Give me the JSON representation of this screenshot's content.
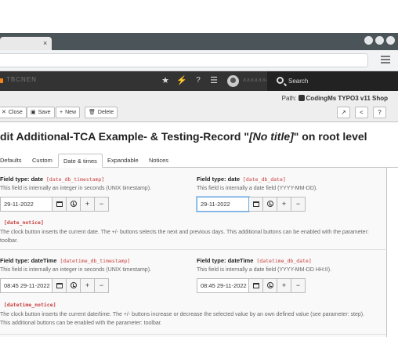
{
  "browser": {
    "tab_close": "×",
    "url": "",
    "menu_icon": "hamburger-icon"
  },
  "topbar": {
    "site_name": "TBCNEN",
    "icons": [
      "star-icon",
      "bolt-icon",
      "help-icon",
      "list-icon"
    ],
    "username": "aaaaaaa",
    "search_label": "Search"
  },
  "docheader": {
    "path_prefix": "Path:",
    "path_value": "CodingMs TYPO3 v11 Shop",
    "buttons": {
      "close": "Close",
      "save": "Save",
      "new": "New",
      "delete": "Delete"
    },
    "right_icons": [
      "open-new-window-icon",
      "share-icon",
      "help-icon"
    ]
  },
  "title": {
    "prefix": "dit Additional-TCA Example- & Testing-Record \"",
    "italic": "[No title]",
    "suffix": "\" on root level"
  },
  "tabs": [
    "Defaults",
    "Custom",
    "Date & times",
    "Expandable",
    "Notices"
  ],
  "active_tab": "Date & times",
  "fields": {
    "date_timestamp": {
      "label": "Field type: date",
      "code": "[date_db_timestamp]",
      "description": "This field is internally an integer in seconds (UNIX timestamp).",
      "value": "29-11-2022"
    },
    "date_date": {
      "label": "Field type: date",
      "code": "[date_db_date]",
      "description": "This field is internally a date field (YYYY-MM-DD).",
      "value": "29-11-2022"
    },
    "date_notice": {
      "code": "[date_notice]",
      "text": "The clock button inserts the current date. The +/- buttons selects the next and previous days. This additional buttons can be enabled with the parameter: toolbar."
    },
    "datetime_timestamp": {
      "label": "Field type: dateTime",
      "code": "[datetime_db_timestamp]",
      "description": "This field is internally an integer in seconds (UNIX timestamp).",
      "value": "08:45 29-11-2022"
    },
    "datetime_date": {
      "label": "Field type: dateTime",
      "code": "[datetime_db_date]",
      "description": "This field is internally a date field (YYYY-MM-DD HH:II).",
      "value": "08:45 29-11-2022"
    },
    "datetime_notice": {
      "code": "[datetime_notice]",
      "text": "The clock button inserts the current date/time. The +/- buttons increase or decrease the selected value by an own defined value (see parameter: step). This additional buttons can be enabled with the parameter: toolbar."
    }
  },
  "field_buttons": {
    "calendar": "calendar-icon",
    "clock": "clock-icon",
    "plus": "+",
    "minus": "−"
  },
  "colors": {
    "topbar": "#333333",
    "code": "#c83c3c",
    "focus": "#6daae0"
  }
}
